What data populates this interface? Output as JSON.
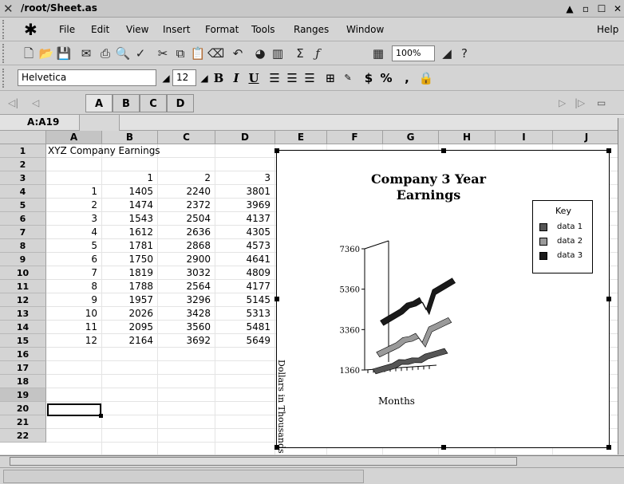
{
  "window": {
    "title": "/root/Sheet.as",
    "controls": [
      "pin-icon",
      "minimize-icon",
      "maximize-icon",
      "close-icon"
    ]
  },
  "menubar": {
    "items": [
      {
        "label": "File"
      },
      {
        "label": "Edit"
      },
      {
        "label": "View"
      },
      {
        "label": "Insert"
      },
      {
        "label": "Format"
      },
      {
        "label": "Tools"
      },
      {
        "label": "Ranges"
      },
      {
        "label": "Window"
      }
    ],
    "help": "Help"
  },
  "toolbar": {
    "zoom": "100%",
    "icons": [
      "new-document-icon",
      "open-folder-icon",
      "save-icon",
      "mail-icon",
      "print-icon",
      "print-preview-icon",
      "spellcheck-icon",
      "cut-icon",
      "copy-icon",
      "paste-icon",
      "clear-icon",
      "undo-icon",
      "chart-icon",
      "bar-chart-icon",
      "sum-icon",
      "function-icon",
      "table-icon",
      "zoom-dropdown-icon",
      "help-icon"
    ]
  },
  "formatbar": {
    "font": "Helvetica",
    "size": "12",
    "bold": "B",
    "italic": "I",
    "underline": "U",
    "currency": "$",
    "percent": "%",
    "comma": ","
  },
  "sheets": {
    "tabs": [
      "A",
      "B",
      "C",
      "D"
    ],
    "active": "A"
  },
  "cellref": "A:A19",
  "grid": {
    "columns": [
      "A",
      "B",
      "C",
      "D",
      "E",
      "F",
      "G",
      "H",
      "I",
      "J"
    ],
    "rows": [
      "1",
      "2",
      "3",
      "4",
      "5",
      "6",
      "7",
      "8",
      "9",
      "10",
      "11",
      "12",
      "13",
      "14",
      "15",
      "16",
      "17",
      "18",
      "19",
      "20",
      "21",
      "22"
    ],
    "selected_row": "19",
    "selected_col": "A",
    "title_cell": "XYZ Company Earnings",
    "header_values": [
      "1",
      "2",
      "3"
    ],
    "data": [
      [
        "1",
        "1405",
        "2240",
        "3801"
      ],
      [
        "2",
        "1474",
        "2372",
        "3969"
      ],
      [
        "3",
        "1543",
        "2504",
        "4137"
      ],
      [
        "4",
        "1612",
        "2636",
        "4305"
      ],
      [
        "5",
        "1781",
        "2868",
        "4573"
      ],
      [
        "6",
        "1750",
        "2900",
        "4641"
      ],
      [
        "7",
        "1819",
        "3032",
        "4809"
      ],
      [
        "8",
        "1788",
        "2564",
        "4177"
      ],
      [
        "9",
        "1957",
        "3296",
        "5145"
      ],
      [
        "10",
        "2026",
        "3428",
        "5313"
      ],
      [
        "11",
        "2095",
        "3560",
        "5481"
      ],
      [
        "12",
        "2164",
        "3692",
        "5649"
      ]
    ]
  },
  "chart_data": {
    "type": "area",
    "title": "Company 3 Year Earnings",
    "xlabel": "Months",
    "ylabel": "Dollars in Thousands",
    "yticks": [
      "7360",
      "5360",
      "3360",
      "1360"
    ],
    "ylim": [
      1360,
      7360
    ],
    "x": [
      1,
      2,
      3,
      4,
      5,
      6,
      7,
      8,
      9,
      10,
      11,
      12
    ],
    "legend_title": "Key",
    "legend_position": "top-right",
    "series": [
      {
        "name": "data 1",
        "color": "#555555",
        "values": [
          1405,
          1474,
          1543,
          1612,
          1781,
          1750,
          1819,
          1788,
          1957,
          2026,
          2095,
          2164
        ]
      },
      {
        "name": "data 2",
        "color": "#9a9a9a",
        "values": [
          2240,
          2372,
          2504,
          2636,
          2868,
          2900,
          3032,
          2564,
          3296,
          3428,
          3560,
          3692
        ]
      },
      {
        "name": "data 3",
        "color": "#1a1a1a",
        "values": [
          3801,
          3969,
          4137,
          4305,
          4573,
          4641,
          4809,
          4177,
          5145,
          5313,
          5481,
          5649
        ]
      }
    ]
  }
}
